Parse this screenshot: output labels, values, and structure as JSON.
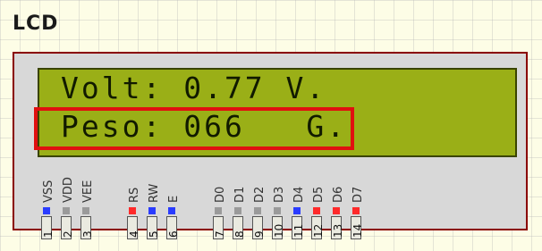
{
  "component": {
    "title": "LCD",
    "display": {
      "line1": "Volt: 0.77 V.",
      "line2": "Peso: 066   G."
    },
    "pins": [
      {
        "label": "VSS",
        "number": "1",
        "color": "#2a3cff"
      },
      {
        "label": "VDD",
        "number": "2",
        "color": "#9a9a9a"
      },
      {
        "label": "VEE",
        "number": "3",
        "color": "#9a9a9a"
      },
      {
        "label": "RS",
        "number": "4",
        "color": "#ff2a2a"
      },
      {
        "label": "RW",
        "number": "5",
        "color": "#2a3cff"
      },
      {
        "label": "E",
        "number": "6",
        "color": "#2a3cff"
      },
      {
        "label": "D0",
        "number": "7",
        "color": "#9a9a9a"
      },
      {
        "label": "D1",
        "number": "8",
        "color": "#9a9a9a"
      },
      {
        "label": "D2",
        "number": "9",
        "color": "#9a9a9a"
      },
      {
        "label": "D3",
        "number": "10",
        "color": "#9a9a9a"
      },
      {
        "label": "D4",
        "number": "11",
        "color": "#2a3cff"
      },
      {
        "label": "D5",
        "number": "12",
        "color": "#ff2a2a"
      },
      {
        "label": "D6",
        "number": "13",
        "color": "#ff2a2a"
      },
      {
        "label": "D7",
        "number": "14",
        "color": "#ff2a2a"
      }
    ],
    "colors": {
      "screen": "#9aaf17",
      "frame_border": "#8a0000",
      "highlight": "#e01010"
    }
  }
}
